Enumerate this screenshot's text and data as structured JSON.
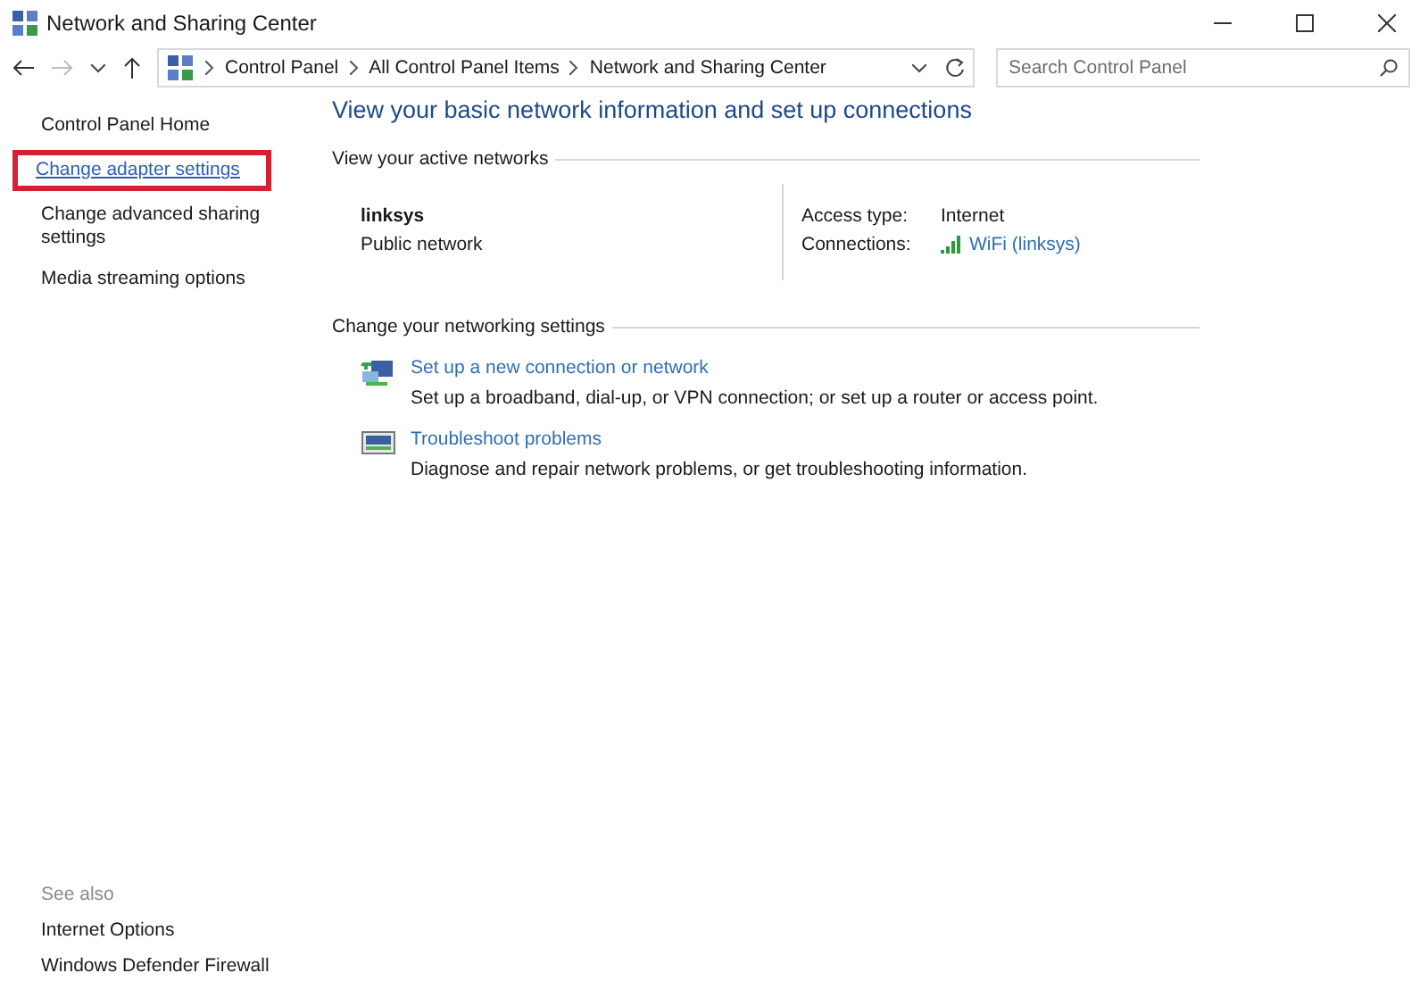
{
  "window": {
    "title": "Network and Sharing Center"
  },
  "address_bar": {
    "breadcrumbs": [
      "Control Panel",
      "All Control Panel Items",
      "Network and Sharing Center"
    ]
  },
  "search": {
    "placeholder": "Search Control Panel"
  },
  "sidebar": {
    "items": [
      {
        "label": "Control Panel Home",
        "kind": "text",
        "highlighted": false
      },
      {
        "label": "Change adapter settings",
        "kind": "link",
        "highlighted": true
      },
      {
        "label": "Change advanced sharing settings",
        "kind": "text",
        "highlighted": false
      },
      {
        "label": "Media streaming options",
        "kind": "text",
        "highlighted": false
      }
    ],
    "see_also": {
      "heading": "See also",
      "items": [
        "Internet Options",
        "Windows Defender Firewall"
      ]
    }
  },
  "main": {
    "title": "View your basic network information and set up connections",
    "active_networks": {
      "heading": "View your active networks",
      "name": "linksys",
      "category": "Public network",
      "access_type_label": "Access type:",
      "access_type": "Internet",
      "connections_label": "Connections:",
      "connection": "WiFi (linksys)"
    },
    "settings": {
      "heading": "Change your networking settings",
      "tasks": [
        {
          "kind": "new-connection",
          "title": "Set up a new connection or network",
          "description": "Set up a broadband, dial-up, or VPN connection; or set up a router or access point."
        },
        {
          "kind": "troubleshoot",
          "title": "Troubleshoot problems",
          "description": "Diagnose and repair network problems, or get troubleshooting information."
        }
      ]
    }
  }
}
